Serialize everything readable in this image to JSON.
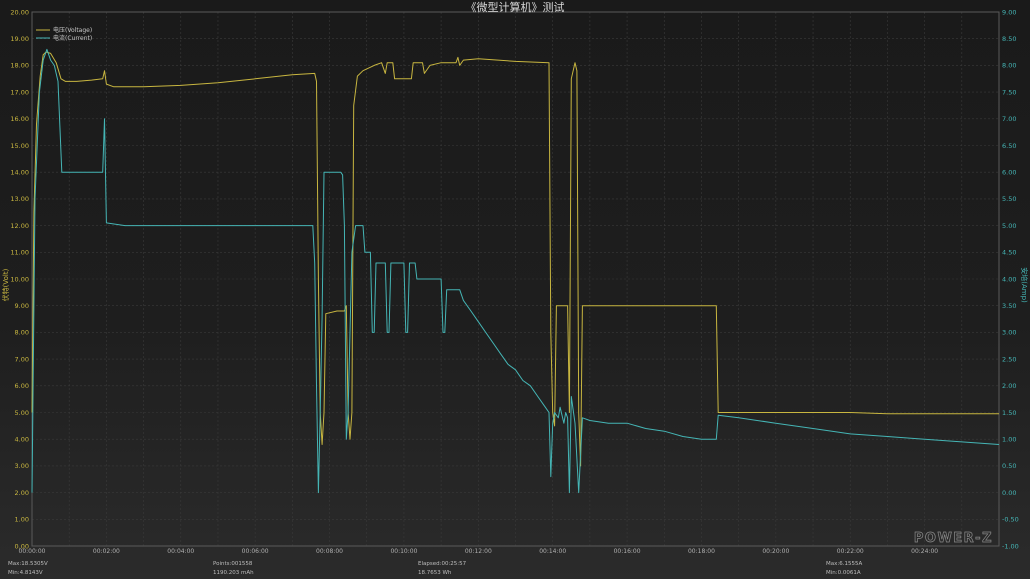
{
  "colors": {
    "voltage": "#c8b640",
    "current": "#45b5b5",
    "grid": "#3a3a3a",
    "frame": "#5a5a5a"
  },
  "brand": "POWER-Z",
  "stats": {
    "v_max": "Max:18.5305V",
    "v_min": "Min:4.8143V",
    "points": "Points:001558",
    "capacity": "1190.203 mAh",
    "elapsed": "Elapsed:00:25:57",
    "energy": "18.7653 Wh",
    "i_max": "Max:6.1555A",
    "i_min": "Min:0.0061A"
  },
  "chart_data": {
    "type": "line",
    "title": "《微型计算机》测试",
    "xlabel": "",
    "ylabel": "伏特(Volt)",
    "y2label": "安培(Amp)",
    "xlim": [
      0,
      26
    ],
    "ylim": [
      0,
      20
    ],
    "y2lim": [
      -1,
      9
    ],
    "x_ticks": [
      "00:00:00",
      "00:02:00",
      "00:04:00",
      "00:06:00",
      "00:08:00",
      "00:10:00",
      "00:12:00",
      "00:14:00",
      "00:16:00",
      "00:18:00",
      "00:20:00",
      "00:22:00",
      "00:24:00"
    ],
    "y_ticks": [
      "0.00",
      "1.00",
      "2.00",
      "3.00",
      "4.00",
      "5.00",
      "6.00",
      "7.00",
      "8.00",
      "9.00",
      "10.00",
      "11.00",
      "12.00",
      "13.00",
      "14.00",
      "15.00",
      "16.00",
      "17.00",
      "18.00",
      "19.00",
      "20.00"
    ],
    "y2_ticks": [
      "-1.00",
      "-0.50",
      "0.00",
      "0.50",
      "1.00",
      "1.50",
      "2.00",
      "2.50",
      "3.00",
      "3.50",
      "4.00",
      "4.50",
      "5.00",
      "5.50",
      "6.00",
      "6.50",
      "7.00",
      "7.50",
      "8.00",
      "8.50",
      "9.00"
    ],
    "grid": true,
    "legend_position": "top-left",
    "series": [
      {
        "name": "电压(Voltage)",
        "axis": "left",
        "points": [
          [
            0,
            5.0
          ],
          [
            0.05,
            12.5
          ],
          [
            0.12,
            15.8
          ],
          [
            0.22,
            17.6
          ],
          [
            0.3,
            18.4
          ],
          [
            0.38,
            18.5
          ],
          [
            0.5,
            18.45
          ],
          [
            0.65,
            18.1
          ],
          [
            0.78,
            17.5
          ],
          [
            0.9,
            17.4
          ],
          [
            1.2,
            17.4
          ],
          [
            1.6,
            17.45
          ],
          [
            1.9,
            17.5
          ],
          [
            1.95,
            17.8
          ],
          [
            2.0,
            17.3
          ],
          [
            2.2,
            17.2
          ],
          [
            3.0,
            17.2
          ],
          [
            4.0,
            17.25
          ],
          [
            5.0,
            17.35
          ],
          [
            6.0,
            17.5
          ],
          [
            7.0,
            17.65
          ],
          [
            7.6,
            17.7
          ],
          [
            7.65,
            17.4
          ],
          [
            7.7,
            10.0
          ],
          [
            7.75,
            5.0
          ],
          [
            7.8,
            3.8
          ],
          [
            7.85,
            5.0
          ],
          [
            7.9,
            8.7
          ],
          [
            8.2,
            8.8
          ],
          [
            8.4,
            8.8
          ],
          [
            8.45,
            9.0
          ],
          [
            8.5,
            5.0
          ],
          [
            8.55,
            4.0
          ],
          [
            8.6,
            5.0
          ],
          [
            8.65,
            16.5
          ],
          [
            8.75,
            17.6
          ],
          [
            8.9,
            17.8
          ],
          [
            9.2,
            18.0
          ],
          [
            9.4,
            18.1
          ],
          [
            9.5,
            17.7
          ],
          [
            9.55,
            18.1
          ],
          [
            9.7,
            18.1
          ],
          [
            9.75,
            17.5
          ],
          [
            10.2,
            17.5
          ],
          [
            10.25,
            18.1
          ],
          [
            10.5,
            18.1
          ],
          [
            10.55,
            17.7
          ],
          [
            10.7,
            18.0
          ],
          [
            11.0,
            18.1
          ],
          [
            11.4,
            18.1
          ],
          [
            11.45,
            18.3
          ],
          [
            11.5,
            18.0
          ],
          [
            11.6,
            18.2
          ],
          [
            12.0,
            18.25
          ],
          [
            13.0,
            18.15
          ],
          [
            13.9,
            18.1
          ],
          [
            13.95,
            8.0
          ],
          [
            14.0,
            5.0
          ],
          [
            14.05,
            4.5
          ],
          [
            14.1,
            9.0
          ],
          [
            14.25,
            9.0
          ],
          [
            14.4,
            9.0
          ],
          [
            14.45,
            5.0
          ],
          [
            14.5,
            17.5
          ],
          [
            14.6,
            18.1
          ],
          [
            14.65,
            17.8
          ],
          [
            14.7,
            5.0
          ],
          [
            14.75,
            3.0
          ],
          [
            14.8,
            9.0
          ],
          [
            15.5,
            9.0
          ],
          [
            16.5,
            9.0
          ],
          [
            17.5,
            9.0
          ],
          [
            18.0,
            9.0
          ],
          [
            18.4,
            9.0
          ],
          [
            18.45,
            5.0
          ],
          [
            19.0,
            5.0
          ],
          [
            20.0,
            5.0
          ],
          [
            21.0,
            5.0
          ],
          [
            22.0,
            5.0
          ],
          [
            23.0,
            4.95
          ],
          [
            24.0,
            4.95
          ],
          [
            25.0,
            4.95
          ],
          [
            26.0,
            4.95
          ]
        ]
      },
      {
        "name": "电流(Current)",
        "axis": "right",
        "points": [
          [
            0,
            0.0
          ],
          [
            0.08,
            5.5
          ],
          [
            0.2,
            7.5
          ],
          [
            0.3,
            8.1
          ],
          [
            0.4,
            8.3
          ],
          [
            0.5,
            8.1
          ],
          [
            0.6,
            8.0
          ],
          [
            0.7,
            7.7
          ],
          [
            0.8,
            6.0
          ],
          [
            0.85,
            6.0
          ],
          [
            1.0,
            6.0
          ],
          [
            1.9,
            6.0
          ],
          [
            1.95,
            7.0
          ],
          [
            2.0,
            5.05
          ],
          [
            2.5,
            5.0
          ],
          [
            4.0,
            5.0
          ],
          [
            6.0,
            5.0
          ],
          [
            7.55,
            5.0
          ],
          [
            7.6,
            4.3
          ],
          [
            7.65,
            2.0
          ],
          [
            7.7,
            0.0
          ],
          [
            7.75,
            1.5
          ],
          [
            7.8,
            3.3
          ],
          [
            7.85,
            6.0
          ],
          [
            8.0,
            6.0
          ],
          [
            8.3,
            6.0
          ],
          [
            8.35,
            5.95
          ],
          [
            8.4,
            5.0
          ],
          [
            8.45,
            1.0
          ],
          [
            8.5,
            1.5
          ],
          [
            8.6,
            4.5
          ],
          [
            8.7,
            5.0
          ],
          [
            8.8,
            5.0
          ],
          [
            8.9,
            5.0
          ],
          [
            8.95,
            4.5
          ],
          [
            9.1,
            4.5
          ],
          [
            9.15,
            3.0
          ],
          [
            9.2,
            3.0
          ],
          [
            9.25,
            4.3
          ],
          [
            9.5,
            4.3
          ],
          [
            9.55,
            3.0
          ],
          [
            9.6,
            3.0
          ],
          [
            9.65,
            4.3
          ],
          [
            10.0,
            4.3
          ],
          [
            10.05,
            3.0
          ],
          [
            10.1,
            3.0
          ],
          [
            10.15,
            4.3
          ],
          [
            10.3,
            4.3
          ],
          [
            10.35,
            4.0
          ],
          [
            11.0,
            4.0
          ],
          [
            11.05,
            3.0
          ],
          [
            11.1,
            3.0
          ],
          [
            11.15,
            3.8
          ],
          [
            11.5,
            3.8
          ],
          [
            11.6,
            3.6
          ],
          [
            11.8,
            3.4
          ],
          [
            12.0,
            3.2
          ],
          [
            12.2,
            3.0
          ],
          [
            12.4,
            2.8
          ],
          [
            12.6,
            2.6
          ],
          [
            12.8,
            2.4
          ],
          [
            13.0,
            2.3
          ],
          [
            13.2,
            2.1
          ],
          [
            13.4,
            2.0
          ],
          [
            13.6,
            1.8
          ],
          [
            13.8,
            1.6
          ],
          [
            13.9,
            1.5
          ],
          [
            13.95,
            0.3
          ],
          [
            14.0,
            1.3
          ],
          [
            14.05,
            1.5
          ],
          [
            14.15,
            1.4
          ],
          [
            14.2,
            1.6
          ],
          [
            14.3,
            1.3
          ],
          [
            14.35,
            1.5
          ],
          [
            14.4,
            1.4
          ],
          [
            14.45,
            0.0
          ],
          [
            14.5,
            1.8
          ],
          [
            14.6,
            1.3
          ],
          [
            14.7,
            0.0
          ],
          [
            14.8,
            1.4
          ],
          [
            15.0,
            1.35
          ],
          [
            15.5,
            1.3
          ],
          [
            16.0,
            1.3
          ],
          [
            16.5,
            1.2
          ],
          [
            17.0,
            1.15
          ],
          [
            17.5,
            1.05
          ],
          [
            18.0,
            1.0
          ],
          [
            18.4,
            1.0
          ],
          [
            18.45,
            1.45
          ],
          [
            19.0,
            1.4
          ],
          [
            20.0,
            1.3
          ],
          [
            21.0,
            1.2
          ],
          [
            22.0,
            1.1
          ],
          [
            23.0,
            1.05
          ],
          [
            24.0,
            1.0
          ],
          [
            25.0,
            0.95
          ],
          [
            26.0,
            0.9
          ]
        ]
      }
    ]
  }
}
